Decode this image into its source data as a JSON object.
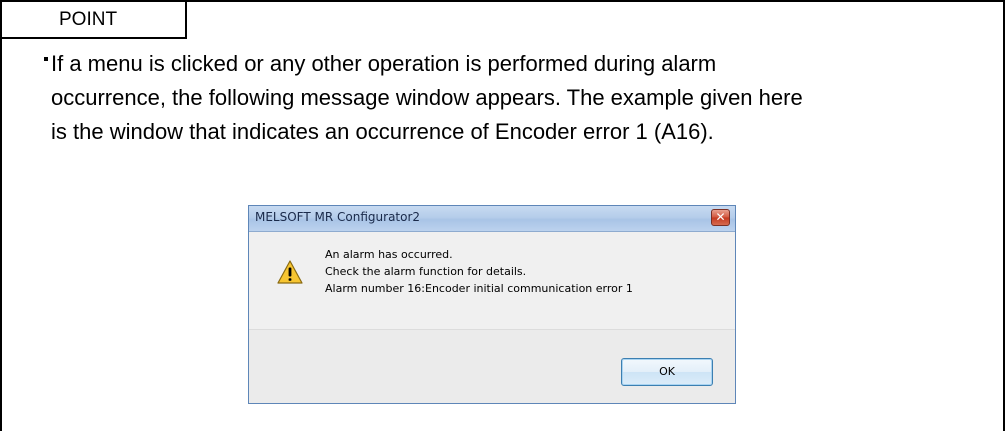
{
  "point_label": "POINT",
  "paragraph": [
    "If a menu is clicked or any other operation is performed during alarm",
    "occurrence, the following message window appears. The example given here",
    "is the window that indicates an occurrence of Encoder error 1 (A16)."
  ],
  "dialog": {
    "title": "MELSOFT MR Configurator2",
    "close_glyph": "✕",
    "icon": "warning-icon",
    "message_lines": [
      "An alarm has occurred.",
      "Check the alarm function for details.",
      "Alarm number 16:Encoder initial communication error 1"
    ],
    "ok_label": "OK"
  },
  "colors": {
    "titlebar": "#b5cdea",
    "close_button": "#c4391f",
    "warning_fill": "#f7c531"
  }
}
